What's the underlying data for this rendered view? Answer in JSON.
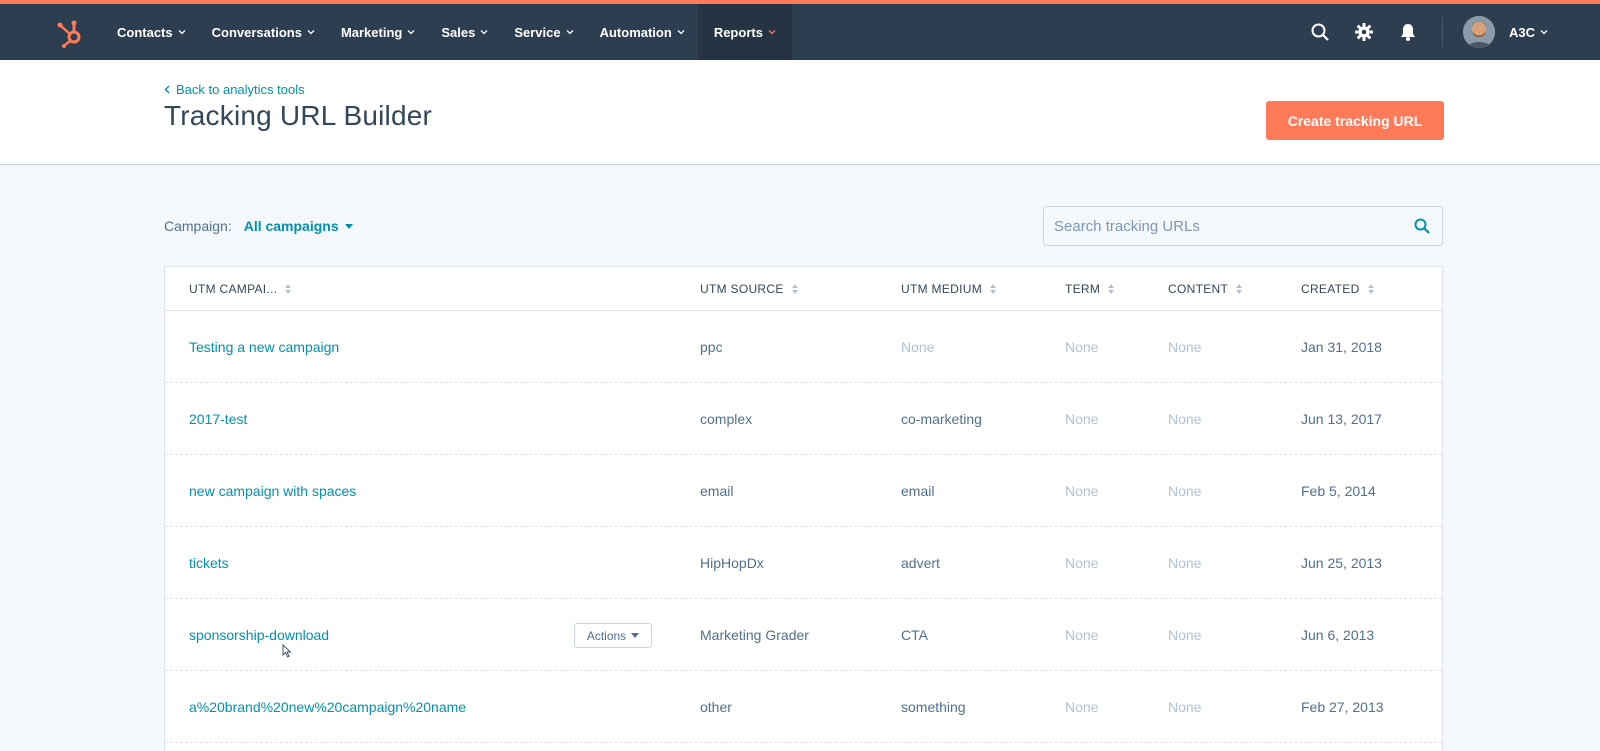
{
  "nav": {
    "items": [
      {
        "label": "Contacts"
      },
      {
        "label": "Conversations"
      },
      {
        "label": "Marketing"
      },
      {
        "label": "Sales"
      },
      {
        "label": "Service"
      },
      {
        "label": "Automation"
      },
      {
        "label": "Reports"
      }
    ],
    "active": "Reports",
    "account_name": "A3C"
  },
  "header": {
    "back_link": "Back to analytics tools",
    "title": "Tracking URL Builder",
    "create_button": "Create tracking URL"
  },
  "filters": {
    "campaign_label": "Campaign:",
    "campaign_value": "All campaigns",
    "search_placeholder": "Search tracking URLs"
  },
  "table": {
    "columns": [
      "UTM CAMPAI...",
      "UTM SOURCE",
      "UTM MEDIUM",
      "TERM",
      "CONTENT",
      "CREATED"
    ],
    "actions_label": "Actions",
    "rows": [
      {
        "campaign": "Testing a new campaign",
        "source": "ppc",
        "medium": "None",
        "term": "None",
        "content": "None",
        "created": "Jan 31, 2018"
      },
      {
        "campaign": "2017-test",
        "source": "complex",
        "medium": "co-marketing",
        "term": "None",
        "content": "None",
        "created": "Jun 13, 2017"
      },
      {
        "campaign": "new campaign with spaces",
        "source": "email",
        "medium": "email",
        "term": "None",
        "content": "None",
        "created": "Feb 5, 2014"
      },
      {
        "campaign": "tickets",
        "source": "HipHopDx",
        "medium": "advert",
        "term": "None",
        "content": "None",
        "created": "Jun 25, 2013"
      },
      {
        "campaign": "sponsorship-download",
        "source": "Marketing Grader",
        "medium": "CTA",
        "term": "None",
        "content": "None",
        "created": "Jun 6, 2013"
      },
      {
        "campaign": "a%20brand%20new%20campaign%20name",
        "source": "other",
        "medium": "something",
        "term": "None",
        "content": "None",
        "created": "Feb 27, 2013"
      }
    ]
  },
  "colors": {
    "accent": "#ff7a59",
    "nav_bg": "#2d3e50",
    "link": "#0091ae"
  }
}
